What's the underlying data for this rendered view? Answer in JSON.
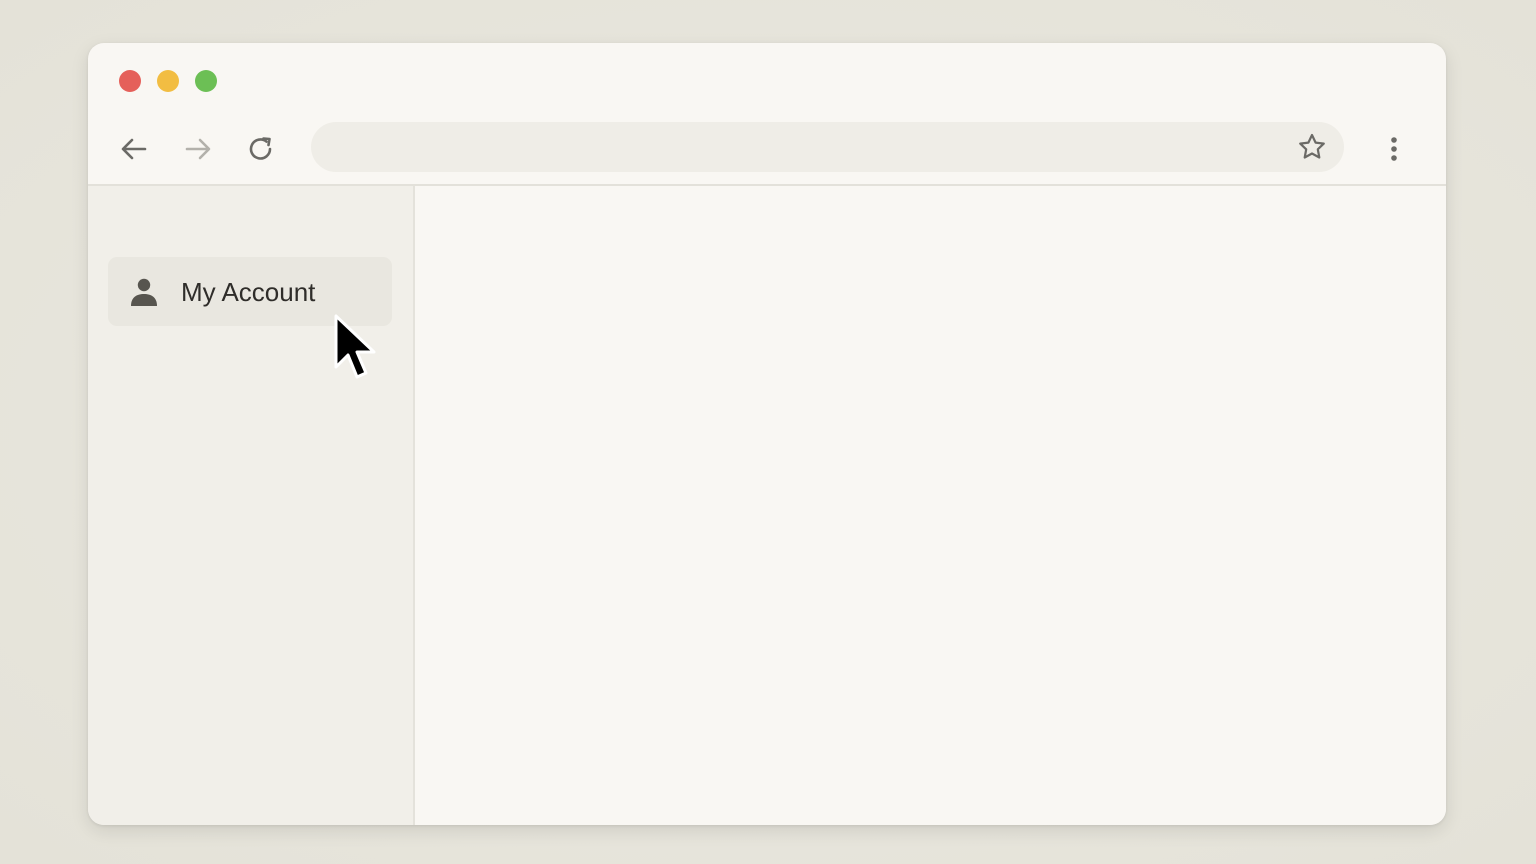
{
  "window": {
    "traffic_lights": {
      "close_color": "#e5605a",
      "minimize_color": "#f2bd42",
      "maximize_color": "#6cbf55"
    }
  },
  "toolbar": {
    "back_icon": "arrow-left-icon",
    "forward_icon": "arrow-right-icon",
    "reload_icon": "reload-icon",
    "address_bar": {
      "value": "",
      "placeholder": ""
    },
    "bookmark_icon": "star-icon",
    "menu_icon": "kebab-menu-icon"
  },
  "sidebar": {
    "items": [
      {
        "label": "My Account",
        "icon": "person-icon",
        "hovered": true
      }
    ]
  },
  "pointer": {
    "icon": "mouse-pointer-icon"
  }
}
